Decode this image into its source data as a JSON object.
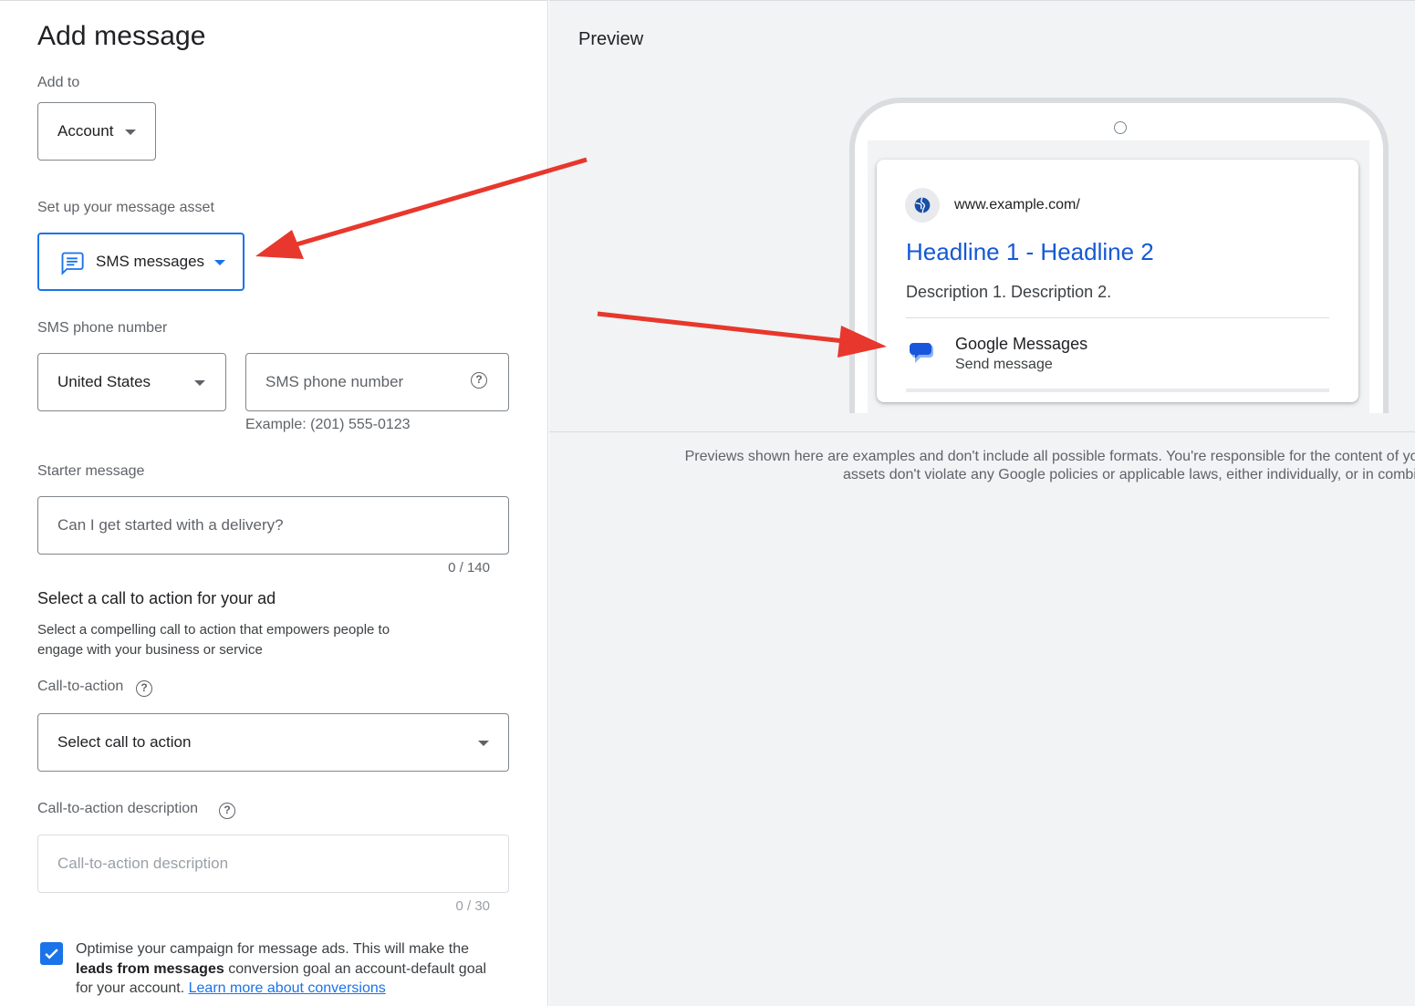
{
  "form": {
    "title": "Add message",
    "add_to_label": "Add to",
    "add_to_value": "Account",
    "setup_label": "Set up your message asset",
    "asset_type_value": "SMS messages",
    "phone_label": "SMS phone number",
    "country_value": "United States",
    "phone_placeholder": "SMS phone number",
    "phone_example": "Example: (201) 555-0123",
    "starter_label": "Starter message",
    "starter_placeholder": "Can I get started with a delivery?",
    "starter_counter": "0 / 140",
    "cta_heading": "Select a call to action for your ad",
    "cta_desc_line1": "Select a compelling call to action that empowers people to",
    "cta_desc_line2": "engage with your business or service",
    "cta_label": "Call-to-action",
    "cta_select_value": "Select call to action",
    "cta_description_label": "Call-to-action description",
    "cta_description_placeholder": "Call-to-action description",
    "cta_description_counter": "0 / 30",
    "optimise_text_1": "Optimise your campaign for message ads. This will make the",
    "optimise_bold": "leads from messages",
    "optimise_text_2": " conversion goal an account-default goal",
    "optimise_text_3": "for your account. ",
    "optimise_link": "Learn more about conversions",
    "optimise_checked": true
  },
  "preview": {
    "title": "Preview",
    "url": "www.example.com/",
    "headline": "Headline 1 - Headline 2",
    "description": "Description 1. Description 2.",
    "message_app": "Google Messages",
    "message_action": "Send message",
    "disclaimer_line1": "Previews shown here are examples and don't include all possible formats. You're responsible for the content of your ads.",
    "disclaimer_line2": "assets don't violate any Google policies or applicable laws, either individually, or in combin"
  },
  "colors": {
    "accent": "#1a73e8",
    "headline": "#1558d6",
    "arrow": "#e8372c",
    "preview_bg": "#f1f3f4"
  }
}
